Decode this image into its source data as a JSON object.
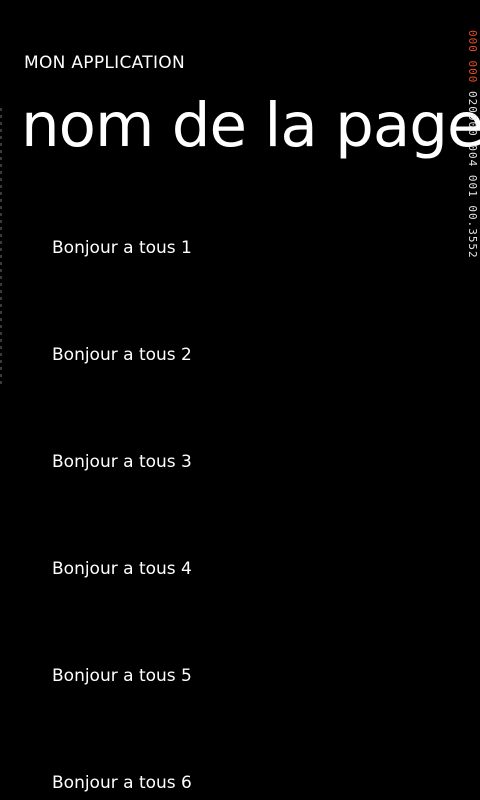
{
  "header": {
    "app_title": "MON APPLICATION",
    "page_title": "nom de la page"
  },
  "list": {
    "items": [
      {
        "label": "Bonjour a tous 1"
      },
      {
        "label": "Bonjour a tous 2"
      },
      {
        "label": "Bonjour a tous 3"
      },
      {
        "label": "Bonjour a tous 4"
      },
      {
        "label": "Bonjour a tous 5"
      },
      {
        "label": "Bonjour a tous 6"
      }
    ]
  },
  "frame_counters": {
    "red_part": "000 000",
    "white_part": "020000 004 001 00.3552"
  },
  "colors": {
    "background": "#000000",
    "foreground": "#ffffff",
    "counter_accent": "#e8502a"
  }
}
